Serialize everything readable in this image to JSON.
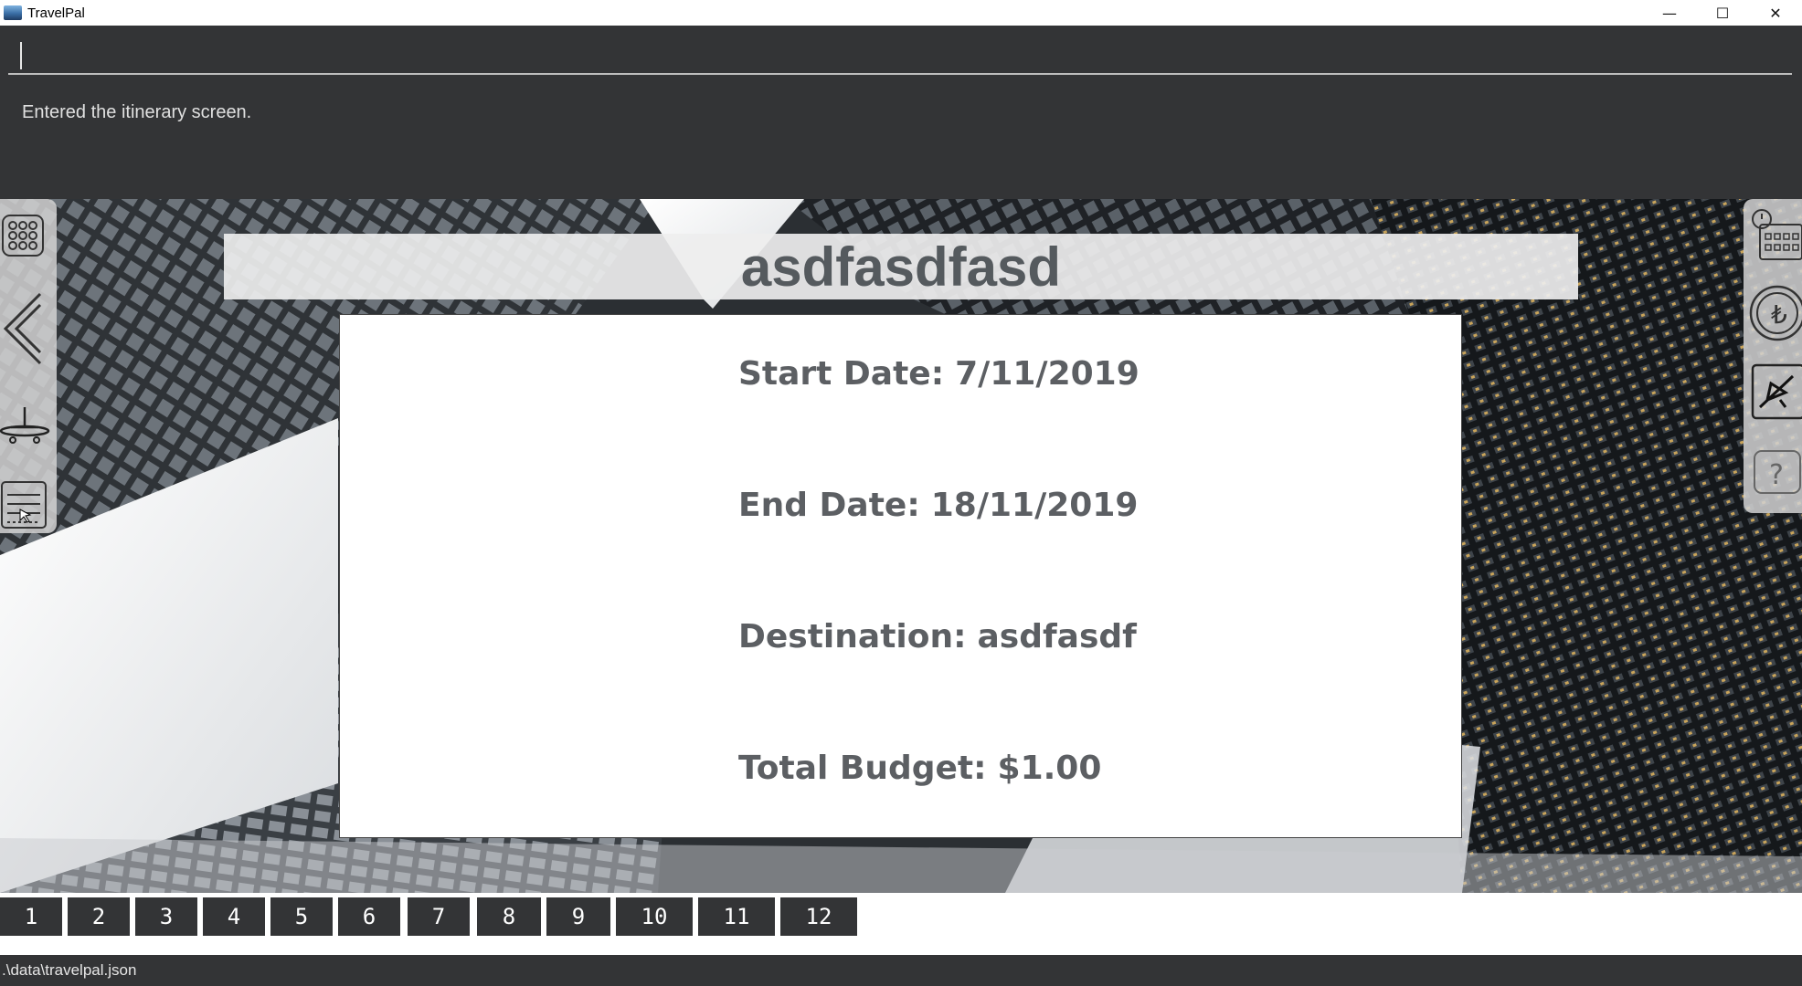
{
  "window": {
    "title": "TravelPal",
    "minimize_glyph": "—",
    "maximize_glyph": "☐",
    "close_glyph": "✕"
  },
  "command": {
    "input_value": "",
    "result_message": "Entered the itinerary screen."
  },
  "itinerary": {
    "name": "asdfasdfasd",
    "start_date": {
      "label": "Start Date:",
      "value": "7/11/2019"
    },
    "end_date": {
      "label": "End Date:",
      "value": "18/11/2019"
    },
    "destination": {
      "label": "Destination:",
      "value": "asdfasdf"
    },
    "total_budget": {
      "label": "Total Budget:",
      "value": "$1.00"
    }
  },
  "left_sidebar": {
    "items": [
      "grid-icon",
      "back-arrow-icon",
      "airplane-icon",
      "list-icon"
    ]
  },
  "right_sidebar": {
    "items": [
      "calendar-clock-icon",
      "currency-icon",
      "flight-icon",
      "help-icon"
    ]
  },
  "day_tabs": [
    "1",
    "2",
    "3",
    "4",
    "5",
    "6",
    "7",
    "8",
    "9",
    "10",
    "11",
    "12"
  ],
  "status_bar": {
    "file_path": ".\\data\\travelpal.json"
  },
  "colors": {
    "dark_panel": "#333436",
    "card_text": "#5c5f63",
    "banner": "#eeeeee"
  }
}
